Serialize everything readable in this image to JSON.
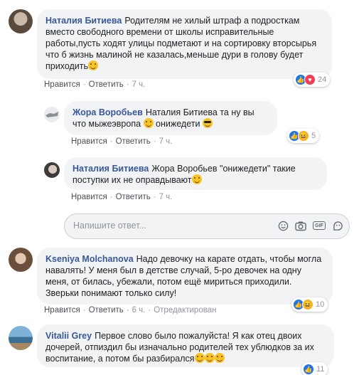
{
  "actions": {
    "like": "Нравится",
    "reply": "Ответить",
    "dot": "·"
  },
  "comments": [
    {
      "author": "Наталия Битиева",
      "text": "Родителям не хилый штраф а подросткам вместо свободного времени от школы исправительные работы,пусть ходят улицы подметают и на сортировку вторсырья что б жизнь малиной не казалась,меньше дури в голову будет приходить",
      "emoji": "smiling-face-emoji",
      "time": "7 ч.",
      "reactions": [
        "like",
        "love"
      ],
      "reaction_count": "24"
    },
    {
      "author": "Жора Воробьев",
      "text_a": "Наталия Битиева та ну вы что мыжеэвропа",
      "text_b": " онижедети",
      "time": "7 ч.",
      "reactions": [
        "like",
        "haha"
      ],
      "reaction_count": "5"
    },
    {
      "author": "Наталия Битиева",
      "text": "Жора Воробьев \"онижедети\" такие поступки их не оправдывают",
      "time": "7 ч."
    },
    {
      "author": "Kseniya Molchanova",
      "text": "Надо девочку на карате отдать, чтобы могла навалять! У меня был в детстве случай, 5-ро девочек на одну меня, от билась, убежали, потом ещё мириться приходили. Зверьки понимают только силу!",
      "time": "6 ч.",
      "edited": "Отредактирован",
      "reactions": [
        "like",
        "haha"
      ],
      "reaction_count": "10"
    },
    {
      "author": "Vitalii Grey",
      "text": "Первое слово было пожалуйста! Я как отец двоих дочерей, отпиздил бы изначально родителей тех ублюдков за их воспитание, а потом бы разбирался",
      "reactions": [
        "like"
      ],
      "reaction_count": "11"
    }
  ],
  "reply_box": {
    "placeholder": "Напишите ответ..."
  },
  "colors": {
    "author": "#385898",
    "bubble": "#f2f3f5",
    "like": "#1877f2",
    "love": "#f33e58",
    "haha": "#f7b125"
  }
}
